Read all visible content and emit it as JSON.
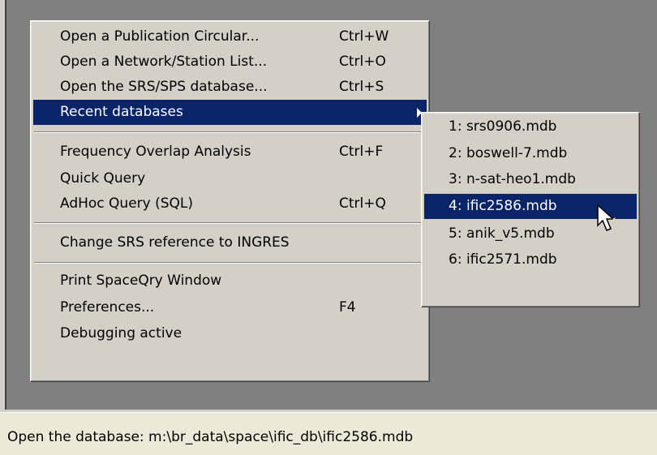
{
  "main_menu": {
    "items": [
      {
        "label": "Open a Publication Circular...",
        "shortcut": "Ctrl+W"
      },
      {
        "label": "Open a Network/Station List...",
        "shortcut": "Ctrl+O"
      },
      {
        "label": "Open the SRS/SPS database...",
        "shortcut": "Ctrl+S"
      },
      {
        "label": "Recent databases",
        "shortcut": ""
      },
      {
        "label": "Frequency Overlap Analysis",
        "shortcut": "Ctrl+F"
      },
      {
        "label": "Quick Query",
        "shortcut": ""
      },
      {
        "label": "AdHoc Query (SQL)",
        "shortcut": "Ctrl+Q"
      },
      {
        "label": "Change SRS reference to INGRES",
        "shortcut": ""
      },
      {
        "label": "Print SpaceQry Window",
        "shortcut": ""
      },
      {
        "label": "Preferences...",
        "shortcut": "F4"
      },
      {
        "label": "Debugging active",
        "shortcut": ""
      }
    ]
  },
  "recent_databases": {
    "items": [
      {
        "label": "1: srs0906.mdb"
      },
      {
        "label": "2: boswell-7.mdb"
      },
      {
        "label": "3: n-sat-heo1.mdb"
      },
      {
        "label": "4: ific2586.mdb"
      },
      {
        "label": "5: anik_v5.mdb"
      },
      {
        "label": "6: ific2571.mdb"
      }
    ]
  },
  "status_bar": {
    "text": "Open the database: m:\\br_data\\space\\ific_db\\ific2586.mdb"
  },
  "colors": {
    "menu_bg": "#d4d0c8",
    "highlight": "#0a246a",
    "workspace": "#808080"
  }
}
